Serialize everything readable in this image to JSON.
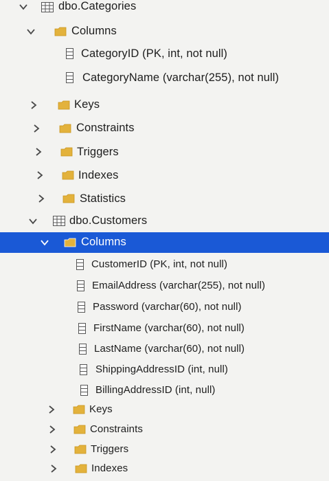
{
  "tree": {
    "categories_table": {
      "label": "dbo.Categories",
      "icon": "table-icon",
      "expanded": true
    },
    "categories_columns": {
      "label": "Columns",
      "icon": "folder-icon",
      "expanded": true
    },
    "categories_columns_items": [
      {
        "label": "CategoryID (PK, int, not null)",
        "icon": "column-icon"
      },
      {
        "label": "CategoryName (varchar(255), not null)",
        "icon": "column-icon"
      }
    ],
    "categories_folders": [
      {
        "label": "Keys",
        "icon": "folder-icon",
        "expanded": false
      },
      {
        "label": "Constraints",
        "icon": "folder-icon",
        "expanded": false
      },
      {
        "label": "Triggers",
        "icon": "folder-icon",
        "expanded": false
      },
      {
        "label": "Indexes",
        "icon": "folder-icon",
        "expanded": false
      },
      {
        "label": "Statistics",
        "icon": "folder-icon",
        "expanded": false
      }
    ],
    "customers_table": {
      "label": "dbo.Customers",
      "icon": "table-icon",
      "expanded": true
    },
    "customers_columns": {
      "label": "Columns",
      "icon": "folder-icon",
      "expanded": true,
      "selected": true
    },
    "customers_columns_items": [
      {
        "label": "CustomerID (PK, int, not null)",
        "icon": "column-icon"
      },
      {
        "label": "EmailAddress (varchar(255), not null)",
        "icon": "column-icon"
      },
      {
        "label": "Password (varchar(60), not null)",
        "icon": "column-icon"
      },
      {
        "label": "FirstName (varchar(60), not null)",
        "icon": "column-icon"
      },
      {
        "label": "LastName (varchar(60), not null)",
        "icon": "column-icon"
      },
      {
        "label": "ShippingAddressID (int, null)",
        "icon": "column-icon"
      },
      {
        "label": "BillingAddressID (int, null)",
        "icon": "column-icon"
      }
    ],
    "customers_folders": [
      {
        "label": "Keys",
        "icon": "folder-icon",
        "expanded": false
      },
      {
        "label": "Constraints",
        "icon": "folder-icon",
        "expanded": false
      },
      {
        "label": "Triggers",
        "icon": "folder-icon",
        "expanded": false
      },
      {
        "label": "Indexes",
        "icon": "folder-icon",
        "expanded": false
      }
    ]
  },
  "colors": {
    "background": "#f3f3f1",
    "selection": "#1a59d6",
    "folder": "#e3b23c",
    "text": "#1d1d1d"
  }
}
